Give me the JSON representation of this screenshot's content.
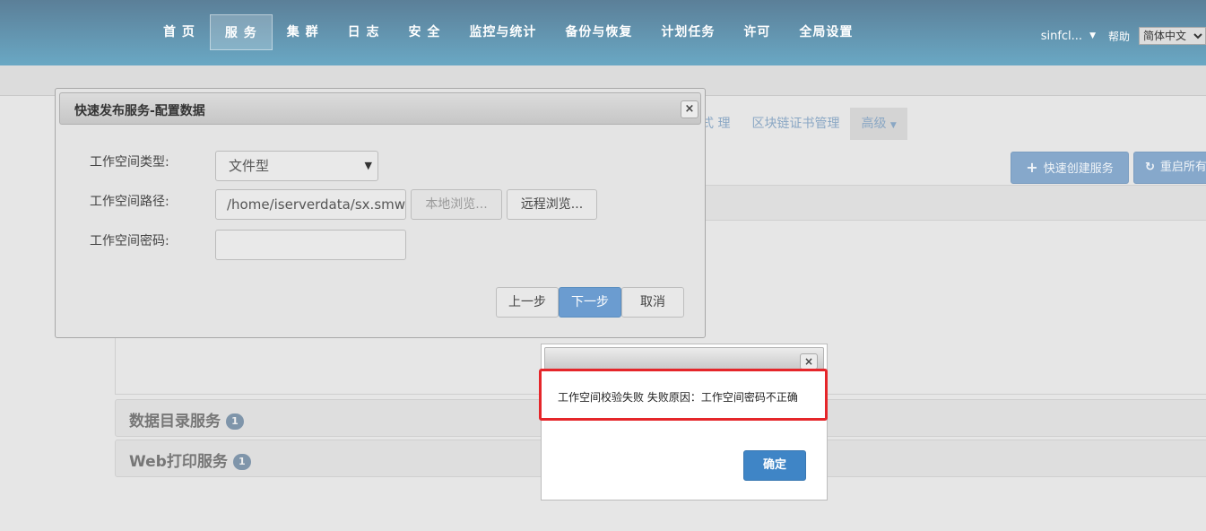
{
  "nav": {
    "items": [
      "首 页",
      "服 务",
      "集 群",
      "日 志",
      "安 全",
      "监控与统计",
      "备份与恢复",
      "计划任务",
      "许可",
      "全局设置"
    ],
    "active_index": 1
  },
  "userbar": {
    "user": "sinfcl...",
    "help": "帮助",
    "language": "简体中文"
  },
  "page": {
    "tabs": [
      "式 理",
      "区块链证书管理",
      "高级"
    ],
    "quick_create_label": "快速创建服务",
    "restart_label": "重启所有",
    "accordions": [
      {
        "title": "数据目录服务",
        "count": "1"
      },
      {
        "title": "Web打印服务",
        "count": "1"
      }
    ]
  },
  "config_dialog": {
    "title": "快速发布服务-配置数据",
    "workspace_type_label": "工作空间类型:",
    "workspace_type_value": "文件型",
    "workspace_path_label": "工作空间路径:",
    "workspace_path_value": "/home/iserverdata/sx.smw",
    "local_browse_label": "本地浏览...",
    "remote_browse_label": "远程浏览...",
    "workspace_password_label": "工作空间密码:",
    "workspace_password_value": "",
    "prev_label": "上一步",
    "next_label": "下一步",
    "cancel_label": "取消"
  },
  "alert": {
    "message": "工作空间校验失败 失败原因：工作空间密码不正确",
    "ok_label": "确定"
  },
  "colors": {
    "header_start": "#5b7f98",
    "header_end": "#6aa8c4",
    "primary": "#3f85c6",
    "highlight": "#e5262a"
  }
}
